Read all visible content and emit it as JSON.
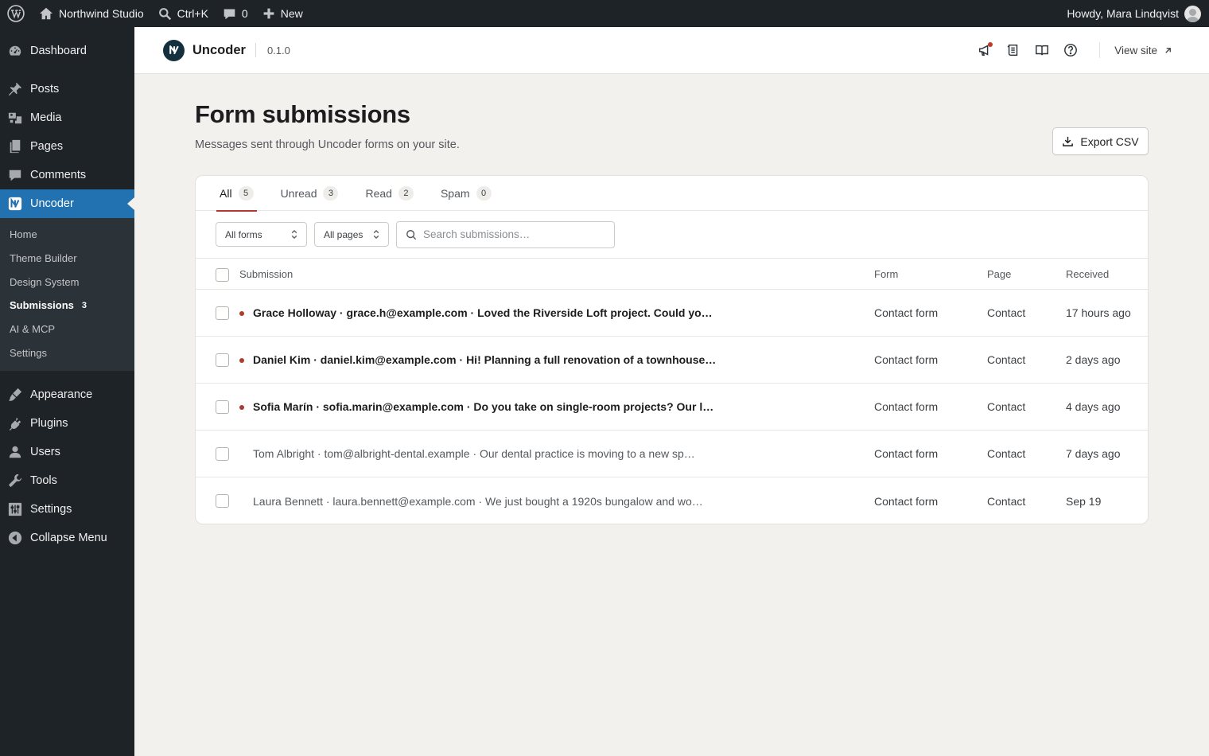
{
  "adminbar": {
    "site_name": "Northwind Studio",
    "search_shortcut": "Ctrl+K",
    "comments_count": "0",
    "new_label": "New",
    "howdy": "Howdy, Mara Lindqvist"
  },
  "sidebar": {
    "dashboard": "Dashboard",
    "posts": "Posts",
    "media": "Media",
    "pages": "Pages",
    "comments": "Comments",
    "uncoder": "Uncoder",
    "sub": {
      "home": "Home",
      "theme_builder": "Theme Builder",
      "design_system": "Design System",
      "submissions": "Submissions",
      "submissions_count": "3",
      "ai_mcp": "AI & MCP",
      "settings": "Settings"
    },
    "appearance": "Appearance",
    "plugins": "Plugins",
    "users": "Users",
    "tools": "Tools",
    "settings": "Settings",
    "collapse": "Collapse Menu"
  },
  "header": {
    "brand": "Uncoder",
    "version": "0.1.0",
    "view_site": "View site"
  },
  "page": {
    "title": "Form submissions",
    "subtitle": "Messages sent through Uncoder forms on your site.",
    "export_label": "Export CSV"
  },
  "tabs": [
    {
      "label": "All",
      "count": "5"
    },
    {
      "label": "Unread",
      "count": "3"
    },
    {
      "label": "Read",
      "count": "2"
    },
    {
      "label": "Spam",
      "count": "0"
    }
  ],
  "filters": {
    "forms": "All forms",
    "pages": "All pages",
    "search_placeholder": "Search submissions…"
  },
  "table": {
    "headers": {
      "submission": "Submission",
      "form": "Form",
      "page": "Page",
      "received": "Received"
    },
    "rows": [
      {
        "summary": "Grace Holloway · grace.h@example.com · Loved the Riverside Loft project. Could yo…",
        "form": "Contact form",
        "page": "Contact",
        "received": "17 hours ago",
        "unread": true
      },
      {
        "summary": "Daniel Kim · daniel.kim@example.com · Hi! Planning a full renovation of a townhouse…",
        "form": "Contact form",
        "page": "Contact",
        "received": "2 days ago",
        "unread": true
      },
      {
        "summary": "Sofia Marín · sofia.marin@example.com · Do you take on single-room projects? Our l…",
        "form": "Contact form",
        "page": "Contact",
        "received": "4 days ago",
        "unread": true
      },
      {
        "summary": "Tom Albright · tom@albright-dental.example · Our dental practice is moving to a new sp…",
        "form": "Contact form",
        "page": "Contact",
        "received": "7 days ago",
        "unread": false
      },
      {
        "summary": "Laura Bennett · laura.bennett@example.com · We just bought a 1920s bungalow and wo…",
        "form": "Contact form",
        "page": "Contact",
        "received": "Sep 19",
        "unread": false
      }
    ]
  },
  "colors": {
    "admin_dark": "#1d2327",
    "accent_blue": "#2271b1",
    "unread_dot": "#b03a2e",
    "page_bg": "#f3f1ee"
  }
}
